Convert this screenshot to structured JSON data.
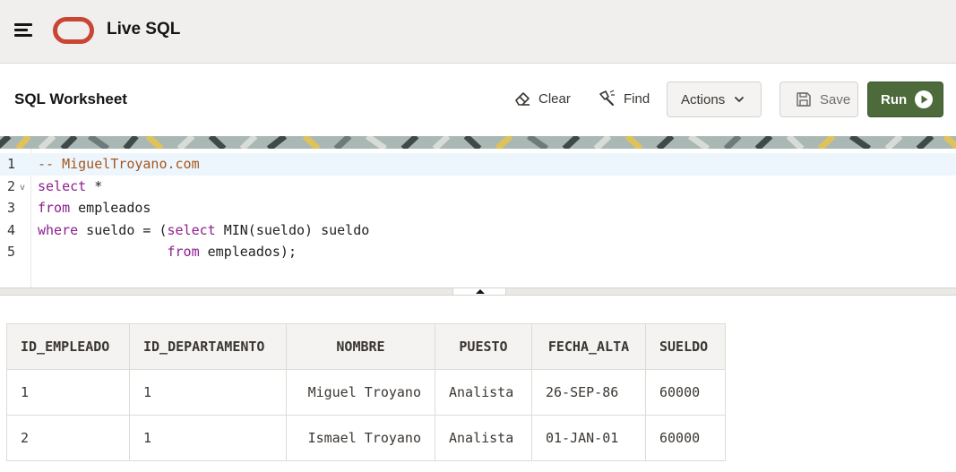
{
  "app": {
    "title": "Live SQL",
    "menu_icon": "hamburger-menu-icon",
    "logo_icon": "oracle-logo-icon",
    "brand_color": "#c74634"
  },
  "worksheet": {
    "title": "SQL Worksheet",
    "clear_label": "Clear",
    "find_label": "Find",
    "actions_label": "Actions",
    "save_label": "Save",
    "run_label": "Run",
    "run_color": "#4c6a3a"
  },
  "editor": {
    "lines": [
      {
        "number": "1",
        "text": "-- MiguelTroyano.com"
      },
      {
        "number": "2",
        "text": "select *"
      },
      {
        "number": "3",
        "text": "from empleados"
      },
      {
        "number": "4",
        "text": "where sueldo = (select MIN(sueldo) sueldo"
      },
      {
        "number": "5",
        "text": "                from empleados);"
      }
    ]
  },
  "results": {
    "columns": [
      "ID_EMPLEADO",
      "ID_DEPARTAMENTO",
      "NOMBRE",
      "PUESTO",
      "FECHA_ALTA",
      "SUELDO"
    ],
    "rows": [
      [
        "1",
        "1",
        "Miguel Troyano",
        "Analista",
        "26-SEP-86",
        "60000"
      ],
      [
        "2",
        "1",
        "Ismael Troyano",
        "Analista",
        "01-JAN-01",
        "60000"
      ]
    ]
  }
}
